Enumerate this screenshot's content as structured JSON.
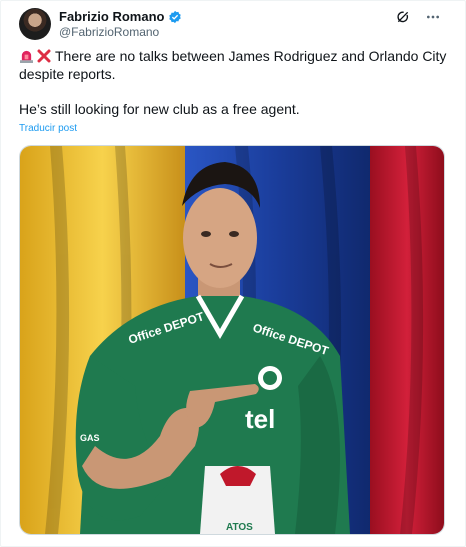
{
  "author": {
    "display_name": "Fabrizio Romano",
    "handle": "@FabrizioRomano"
  },
  "post": {
    "line1": "There are no talks between James Rodriguez and Orlando City despite reports.",
    "line2": "He’s still looking for new club as a free agent.",
    "translate_label": "Traducir post"
  },
  "icons": {
    "verified": "verified-badge-icon",
    "grok": "grok-icon",
    "more": "more-icon",
    "siren": "siren-emoji",
    "cross": "cross-mark-emoji"
  },
  "media": {
    "jersey_sponsor": "Office DEPOT",
    "jersey_brand": "tel",
    "jersey_side_text": "GAS",
    "badge_text": "ATOS"
  },
  "colors": {
    "accent": "#1d9bf0",
    "verified": "#1d9bf0",
    "jersey": "#1f7a4f",
    "flag_yellow": "#f4c62a",
    "flag_blue": "#1a3d9b",
    "flag_red": "#c0182b"
  }
}
